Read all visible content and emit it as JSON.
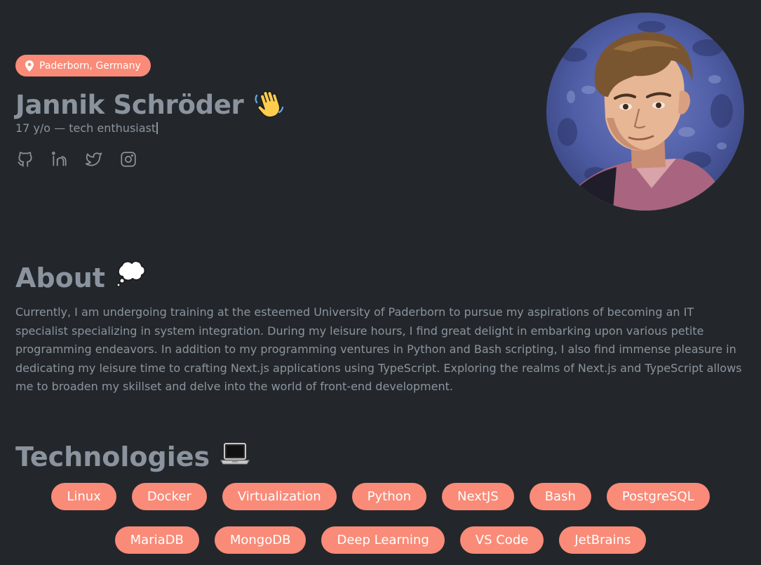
{
  "profile": {
    "location": "Paderborn, Germany",
    "name": "Jannik Schröder",
    "name_emoji": "👋",
    "tagline": "17 y/o — tech enthusiast"
  },
  "socials": [
    {
      "icon": "github-icon"
    },
    {
      "icon": "linkedin-icon"
    },
    {
      "icon": "twitter-icon"
    },
    {
      "icon": "instagram-icon"
    }
  ],
  "about": {
    "title": "About",
    "emoji": "💭",
    "text": "Currently, I am undergoing training at the esteemed University of Paderborn to pursue my aspirations of becoming an IT specialist specializing in system integration. During my leisure hours, I find great delight in embarking upon various petite programming endeavors. In addition to my programming ventures in Python and Bash scripting, I also find immense pleasure in dedicating my leisure time to crafting Next.js applications using TypeScript. Exploring the realms of Next.js and TypeScript allows me to broaden my skillset and delve into the world of front-end development."
  },
  "technologies": {
    "title": "Technologies",
    "emoji": "💻",
    "row1": [
      "Linux",
      "Docker",
      "Virtualization",
      "Python",
      "NextJS",
      "Bash",
      "PostgreSQL"
    ],
    "row2": [
      "MariaDB",
      "MongoDB",
      "Deep Learning",
      "VS Code",
      "JetBrains"
    ]
  },
  "colors": {
    "background": "#23272b",
    "accent": "#f98b78",
    "text": "#8b949e"
  }
}
